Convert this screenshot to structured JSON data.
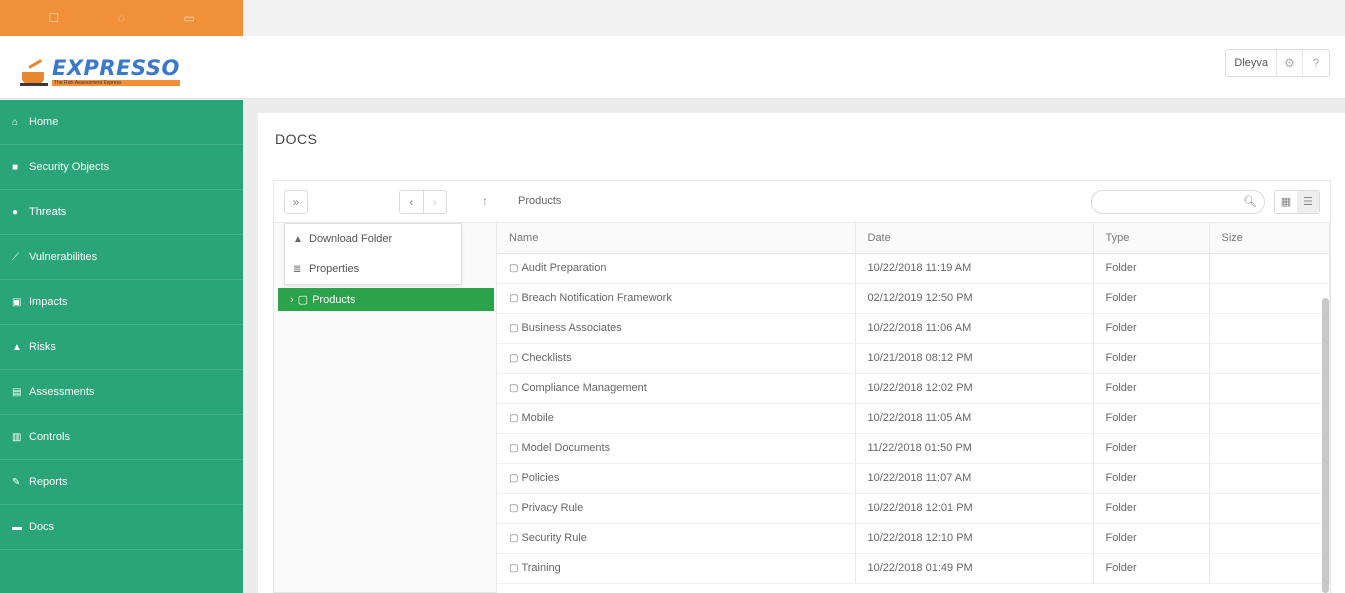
{
  "top_icons": [
    "☐",
    "◌",
    "▭"
  ],
  "brand": {
    "name": "EXPRESSO",
    "tagline": "The Risk Assessment Express"
  },
  "user": {
    "name": "Dleyva",
    "settings_icon": "gear-icon",
    "help_icon": "help-icon"
  },
  "nav": [
    {
      "icon": "home-icon",
      "glyph": "⌂",
      "label": "Home"
    },
    {
      "icon": "lock-icon",
      "glyph": "🔒",
      "label": "Security Objects"
    },
    {
      "icon": "fire-icon",
      "glyph": "●",
      "label": "Threats"
    },
    {
      "icon": "link-icon",
      "glyph": "⟋",
      "label": "Vulnerabilities"
    },
    {
      "icon": "impact-icon",
      "glyph": "▣",
      "label": "Impacts"
    },
    {
      "icon": "warning-icon",
      "glyph": "▲",
      "label": "Risks"
    },
    {
      "icon": "assessment-icon",
      "glyph": "▤",
      "label": "Assessments"
    },
    {
      "icon": "controls-icon",
      "glyph": "▥",
      "label": "Controls"
    },
    {
      "icon": "reports-icon",
      "glyph": "✎",
      "label": "Reports"
    },
    {
      "icon": "folder-icon",
      "glyph": "▬",
      "label": "Docs"
    }
  ],
  "page": {
    "title": "DOCS"
  },
  "toolbar": {
    "breadcrumb": "Products",
    "search_placeholder": ""
  },
  "menu": [
    {
      "icon": "download-icon",
      "glyph": "▲",
      "label": "Download Folder"
    },
    {
      "icon": "properties-icon",
      "glyph": "≣",
      "label": "Properties"
    }
  ],
  "tree": {
    "selected": "Products"
  },
  "columns": [
    "Name",
    "Date",
    "Type",
    "Size"
  ],
  "rows": [
    {
      "name": "Audit Preparation",
      "date": "10/22/2018 11:19 AM",
      "type": "Folder",
      "size": ""
    },
    {
      "name": "Breach Notification Framework",
      "date": "02/12/2019 12:50 PM",
      "type": "Folder",
      "size": ""
    },
    {
      "name": "Business Associates",
      "date": "10/22/2018 11:06 AM",
      "type": "Folder",
      "size": ""
    },
    {
      "name": "Checklists",
      "date": "10/21/2018 08:12 PM",
      "type": "Folder",
      "size": ""
    },
    {
      "name": "Compliance Management",
      "date": "10/22/2018 12:02 PM",
      "type": "Folder",
      "size": ""
    },
    {
      "name": "Mobile",
      "date": "10/22/2018 11:05 AM",
      "type": "Folder",
      "size": ""
    },
    {
      "name": "Model Documents",
      "date": "11/22/2018 01:50 PM",
      "type": "Folder",
      "size": ""
    },
    {
      "name": "Policies",
      "date": "10/22/2018 11:07 AM",
      "type": "Folder",
      "size": ""
    },
    {
      "name": "Privacy Rule",
      "date": "10/22/2018 12:01 PM",
      "type": "Folder",
      "size": ""
    },
    {
      "name": "Security Rule",
      "date": "10/22/2018 12:10 PM",
      "type": "Folder",
      "size": ""
    },
    {
      "name": "Training",
      "date": "10/22/2018 01:49 PM",
      "type": "Folder",
      "size": ""
    }
  ]
}
